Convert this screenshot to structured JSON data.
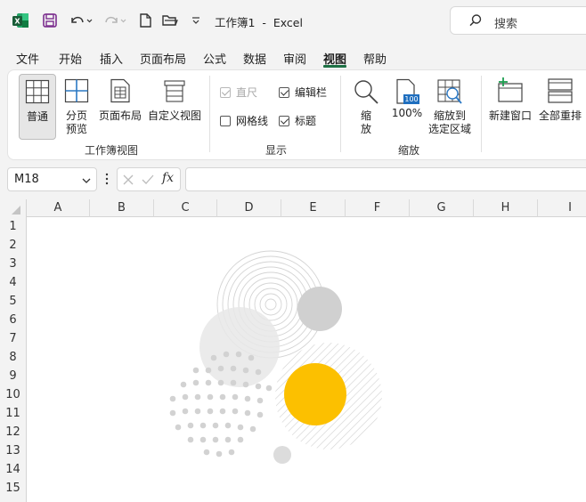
{
  "titlebar": {
    "title": "工作簿1  -  Excel",
    "search_placeholder": "搜索"
  },
  "menu": {
    "tabs": [
      "文件",
      "开始",
      "插入",
      "页面布局",
      "公式",
      "数据",
      "审阅",
      "视图",
      "帮助"
    ],
    "active_tab": "视图"
  },
  "ribbon": {
    "workbook_views": {
      "group_label": "工作簿视图",
      "normal": "普通",
      "page_break_line1": "分页",
      "page_break_line2": "预览",
      "page_layout": "页面布局",
      "custom_views": "自定义视图"
    },
    "show": {
      "group_label": "显示",
      "ruler": "直尺",
      "ruler_checked": true,
      "formula_bar": "编辑栏",
      "formula_bar_checked": true,
      "gridlines": "网格线",
      "gridlines_checked": false,
      "headings": "标题",
      "headings_checked": true
    },
    "zoom": {
      "group_label": "缩放",
      "zoom_line1": "缩",
      "zoom_line2": "放",
      "zoom_100": "100%",
      "zoom_100_icon_text": "100",
      "zoom_selection_line1": "缩放到",
      "zoom_selection_line2": "选定区域"
    },
    "window": {
      "new_window": "新建窗口",
      "arrange_all": "全部重排"
    }
  },
  "formula_bar": {
    "name_box": "M18",
    "formula": "",
    "fx": "fx"
  },
  "sheet": {
    "columns": [
      "A",
      "B",
      "C",
      "D",
      "E",
      "F",
      "G",
      "H",
      "I"
    ],
    "rows": [
      "1",
      "2",
      "3",
      "4",
      "5",
      "6",
      "7",
      "8",
      "9",
      "10",
      "11",
      "12",
      "13",
      "14",
      "15"
    ]
  },
  "colors": {
    "excel_green": "#1e7145",
    "accent_yellow": "#fcc000",
    "circle_gray": "#d0d0d0",
    "title_save_purple": "#7b2d8e"
  }
}
